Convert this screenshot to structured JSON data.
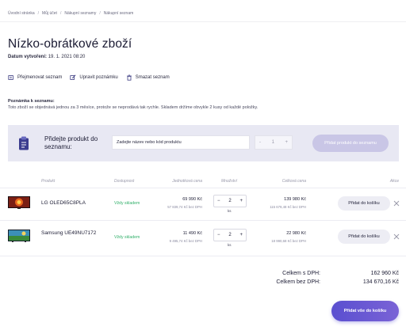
{
  "breadcrumb": [
    "Úvodní stránka",
    "Můj účet",
    "Nákupní seznamy",
    "Nákupní seznam"
  ],
  "page": {
    "title": "Nízko-obrátkové zboží",
    "created_label": "Datum vytvoření:",
    "created_value": "19. 1. 2021 08:20"
  },
  "actions": {
    "rename": "Přejmenovat seznam",
    "edit_note": "Upravit poznámku",
    "delete": "Smazat seznam"
  },
  "note": {
    "title": "Poznámka k seznamu:",
    "text": "Toto zboží se objednává jednou za 3 měsíce, protože se neprodává tak rychle. Skladem držíme obvykle 2 kusy od každé položky."
  },
  "add_product": {
    "label": "Přidejte produkt do seznamu:",
    "search_placeholder": "Zadejte název nebo kód produktu",
    "qty_minus": "-",
    "qty_value": "1",
    "qty_plus": "+",
    "button": "Přidat produkt do seznamu"
  },
  "table": {
    "headers": {
      "product": "Produkt",
      "availability": "Dostupnost",
      "unit_price": "Jednotková cena",
      "quantity": "Množství",
      "total_price": "Celková cena",
      "action": "Akce"
    },
    "rows": [
      {
        "name": "LG OLED65C8PLA",
        "stock": "Vždy skladem",
        "price": "69 990 Kč",
        "price_ex_vat": "57 839,74 Kč bez DPH",
        "qty_minus": "−",
        "qty": "2",
        "qty_plus": "+",
        "unit": "ks",
        "total": "139 980 Kč",
        "total_ex_vat": "115 679,48 Kč bez DPH",
        "cart_button": "Přidat do košíku"
      },
      {
        "name": "Samsung UE49NU7172",
        "stock": "Vždy skladem",
        "price": "11 490 Kč",
        "price_ex_vat": "9 495,74 Kč bez DPH",
        "qty_minus": "−",
        "qty": "2",
        "qty_plus": "+",
        "unit": "ks",
        "total": "22 980 Kč",
        "total_ex_vat": "18 990,68 Kč bez DPH",
        "cart_button": "Přidat do košíku"
      }
    ]
  },
  "summary": {
    "with_vat_label": "Celkem s DPH:",
    "with_vat_value": "162 960 Kč",
    "without_vat_label": "Celkem bez DPH:",
    "without_vat_value": "134 670,16 Kč"
  },
  "add_all_button": "Přidat vše do košíku",
  "colors": {
    "accent": "#6a5acd",
    "in_stock": "#32b06a",
    "add_box_bg": "#e8e8f3"
  }
}
